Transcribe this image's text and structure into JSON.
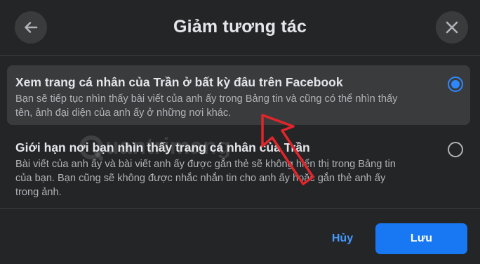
{
  "dialog": {
    "title": "Giảm tương tác",
    "back_icon": "arrow-left-icon",
    "close_icon": "close-icon"
  },
  "options": [
    {
      "title": "Xem trang cá nhân của Trần ở bất kỳ đâu trên Facebook",
      "desc_lines": [
        "Bạn sẽ tiếp tục nhìn thấy bài viết của anh ấy trong Bảng tin và cũng có thể nhìn thấy",
        "tên, ảnh đại diện của anh ấy ở những nơi khác."
      ],
      "selected": true
    },
    {
      "title": "Giới hạn nơi bạn nhìn thấy trang cá nhân của Trần",
      "desc_lines": [
        "Bài viết của anh ấy và bài viết anh ấy được gắn thẻ sẽ không hiển thị trong Bảng tin",
        "của bạn. Bạn cũng sẽ không được nhắc nhắn tin cho anh ấy hoặc gắn thẻ anh ấy",
        "trong ảnh."
      ],
      "selected": false
    }
  ],
  "footer": {
    "cancel_label": "Hủy",
    "save_label": "Lưu"
  },
  "watermark": {
    "text": "uantrimang",
    "logo": "quantrimang-logo"
  },
  "colors": {
    "background": "#242526",
    "selected_option_bg": "#3a3b3c",
    "accent": "#1877f2",
    "radio_active": "#2d88ff",
    "link_blue": "#4599ff",
    "annotation_red": "#e0252b"
  }
}
